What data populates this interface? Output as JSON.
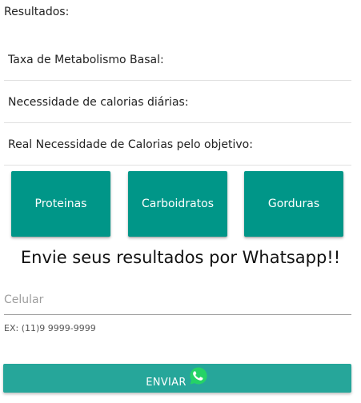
{
  "results": {
    "heading": "Resultados:",
    "rows": [
      {
        "label": "Taxa de Metabolismo Basal:"
      },
      {
        "label": "Necessidade de calorias diárias:"
      },
      {
        "label": "Real Necessidade de Calorias pelo objetivo:"
      }
    ]
  },
  "macros": {
    "buttons": [
      {
        "label": "Proteinas"
      },
      {
        "label": "Carboidratos"
      },
      {
        "label": "Gorduras"
      }
    ]
  },
  "whatsapp": {
    "title": "Envie seus resultados por Whatsapp!!",
    "phone_placeholder": "Celular",
    "phone_value": "",
    "helper": "EX: (11)9 9999-9999",
    "send_label": "ENVIAR",
    "icon": "whatsapp-icon"
  },
  "colors": {
    "macro_button": "#009688",
    "send_button": "#26a69a",
    "whatsapp_icon": "#25d366"
  }
}
